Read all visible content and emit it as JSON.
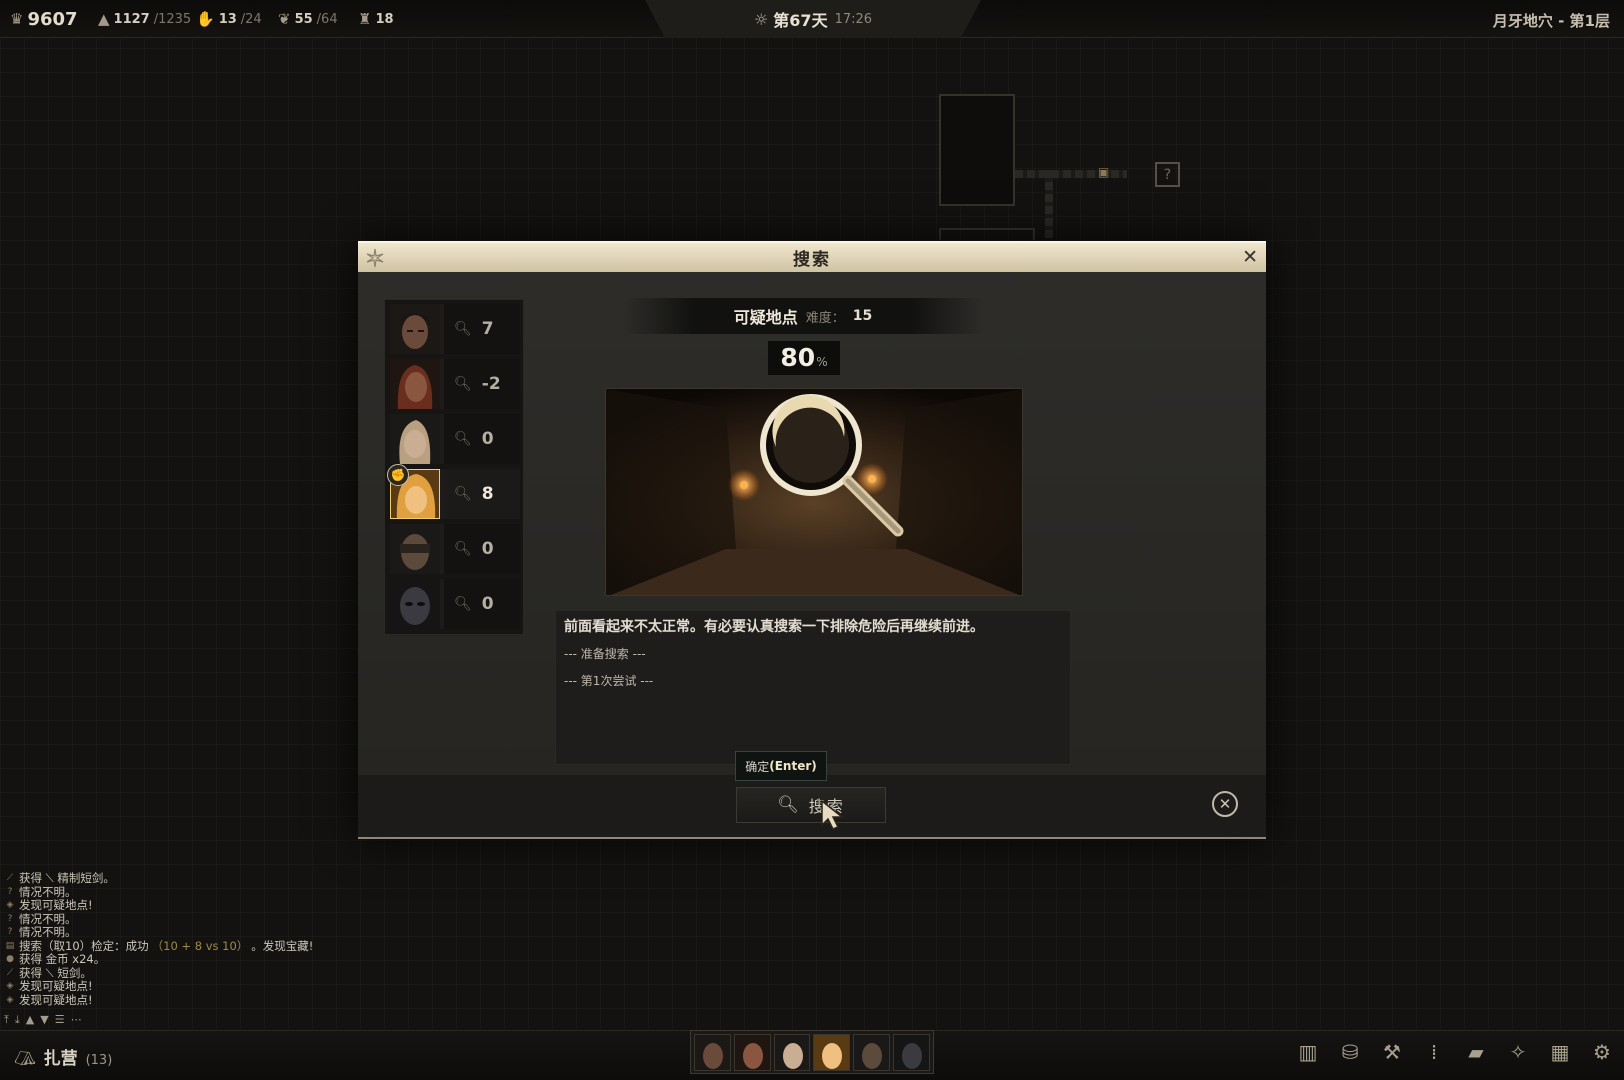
{
  "topbar": {
    "gold": "9607",
    "food_value": "1127",
    "food_max": "/1235",
    "morale_value": "13",
    "morale_max": "/24",
    "supplies_value": "55",
    "supplies_max": "/64",
    "trophies": "18",
    "day": "第67天",
    "time": "17:26",
    "location": "月牙地穴 - 第1层"
  },
  "dialog": {
    "title": "搜索",
    "site_name": "可疑地点",
    "difficulty_label": "难度：",
    "difficulty": "15",
    "success_percent": "80",
    "percent_unit": "%",
    "description": "前面看起来不太正常。有必要认真搜索一下排除危险后再继续前进。",
    "log_lines": [
      "--- 准备搜索 ---",
      "--- 第1次尝试 ---"
    ],
    "tooltip_prefix": "确定",
    "tooltip_key": "(Enter)",
    "search_button": "搜索"
  },
  "party": [
    {
      "score": "7",
      "face": "#6a4a3a"
    },
    {
      "score": "-2",
      "face": "#7a4a36"
    },
    {
      "score": "0",
      "face": "#b49a82"
    },
    {
      "score": "8",
      "face": "#d8a050",
      "active": true
    },
    {
      "score": "0",
      "face": "#5c4a3c"
    },
    {
      "score": "0",
      "face": "#3a3a40"
    }
  ],
  "chat": [
    {
      "icon": "sword-icon",
      "text": "获得 ⟍ 精制短剑。"
    },
    {
      "icon": "question-icon",
      "text": "情况不明。"
    },
    {
      "icon": "alert-icon",
      "text": "发现可疑地点!"
    },
    {
      "icon": "question-icon",
      "text": "情况不明。"
    },
    {
      "icon": "question-icon",
      "text": "情况不明。"
    },
    {
      "icon": "search-icon",
      "text": "搜索（取10）检定：成功",
      "highlight": "（10 + 8 vs 10）",
      "tail": "。发现宝藏!"
    },
    {
      "icon": "coin-icon",
      "text": "获得 金币 x24。"
    },
    {
      "icon": "sword-icon",
      "text": "获得 ⟍ 短剑。"
    },
    {
      "icon": "alert-icon",
      "text": "发现可疑地点!"
    },
    {
      "icon": "alert-icon",
      "text": "发现可疑地点!"
    }
  ],
  "bottombar": {
    "camp_label": "扎营",
    "camp_count": "(13)"
  },
  "colors": {
    "accent_gold": "#f0cf74",
    "header_parchment": "#e8dcc0"
  }
}
